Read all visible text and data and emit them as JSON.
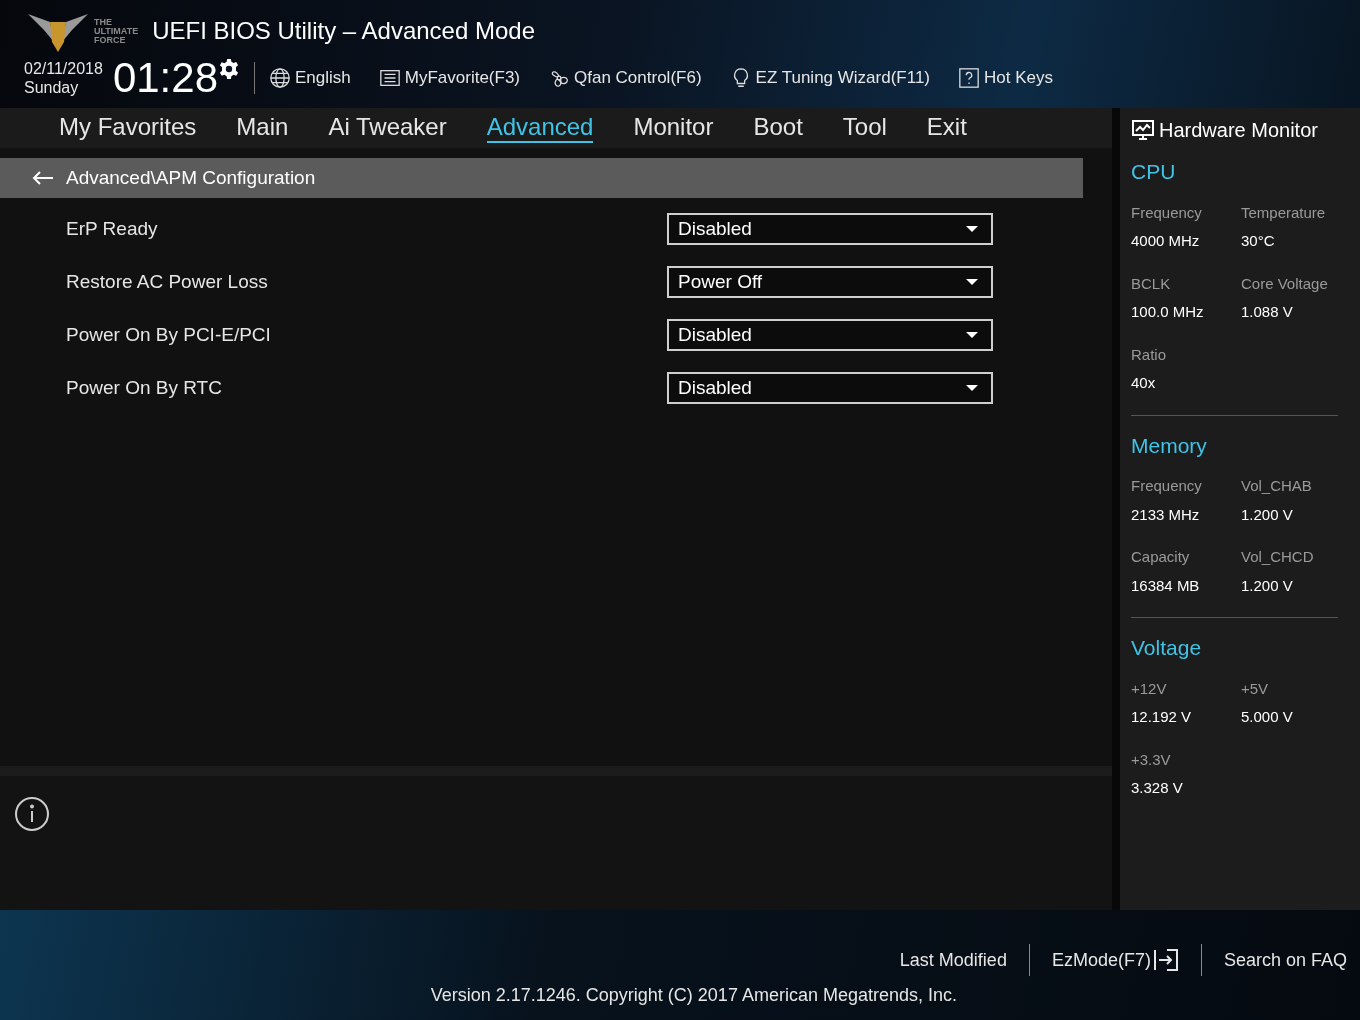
{
  "header": {
    "logo_text": [
      "THE",
      "ULTIMATE",
      "FORCE"
    ],
    "title": "UEFI BIOS Utility – Advanced Mode",
    "date": "02/11/2018",
    "day": "Sunday",
    "time": "01:28",
    "toolbar": [
      {
        "kind": "globe",
        "label": "English"
      },
      {
        "kind": "list",
        "label": "MyFavorite(F3)"
      },
      {
        "kind": "fan",
        "label": "Qfan Control(F6)"
      },
      {
        "kind": "bulb",
        "label": "EZ Tuning Wizard(F11)"
      },
      {
        "kind": "help",
        "label": "Hot Keys"
      }
    ]
  },
  "tabs": [
    {
      "label": "My Favorites",
      "selected": false
    },
    {
      "label": "Main",
      "selected": false
    },
    {
      "label": "Ai Tweaker",
      "selected": false
    },
    {
      "label": "Advanced",
      "selected": true
    },
    {
      "label": "Monitor",
      "selected": false
    },
    {
      "label": "Boot",
      "selected": false
    },
    {
      "label": "Tool",
      "selected": false
    },
    {
      "label": "Exit",
      "selected": false
    }
  ],
  "breadcrumb": "Advanced\\APM Configuration",
  "settings": [
    {
      "label": "ErP Ready",
      "value": "Disabled"
    },
    {
      "label": "Restore AC Power Loss",
      "value": "Power Off"
    },
    {
      "label": "Power On By PCI-E/PCI",
      "value": "Disabled"
    },
    {
      "label": "Power On By RTC",
      "value": "Disabled"
    }
  ],
  "hardware_monitor": {
    "title": "Hardware Monitor",
    "sections": [
      {
        "title": "CPU",
        "items": [
          {
            "label": "Frequency",
            "value": "4000 MHz"
          },
          {
            "label": "Temperature",
            "value": "30°C"
          },
          {
            "label": "BCLK",
            "value": "100.0 MHz"
          },
          {
            "label": "Core Voltage",
            "value": "1.088 V"
          },
          {
            "label": "Ratio",
            "value": "40x"
          }
        ]
      },
      {
        "title": "Memory",
        "items": [
          {
            "label": "Frequency",
            "value": "2133 MHz"
          },
          {
            "label": "Vol_CHAB",
            "value": "1.200 V"
          },
          {
            "label": "Capacity",
            "value": "16384 MB"
          },
          {
            "label": "Vol_CHCD",
            "value": "1.200 V"
          }
        ]
      },
      {
        "title": "Voltage",
        "items": [
          {
            "label": "+12V",
            "value": "12.192 V"
          },
          {
            "label": "+5V",
            "value": "5.000 V"
          },
          {
            "label": "+3.3V",
            "value": "3.328 V"
          }
        ]
      }
    ]
  },
  "footer": {
    "links": [
      "Last Modified",
      "EzMode(F7)",
      "Search on FAQ"
    ],
    "version": "Version 2.17.1246. Copyright (C) 2017 American Megatrends, Inc."
  }
}
